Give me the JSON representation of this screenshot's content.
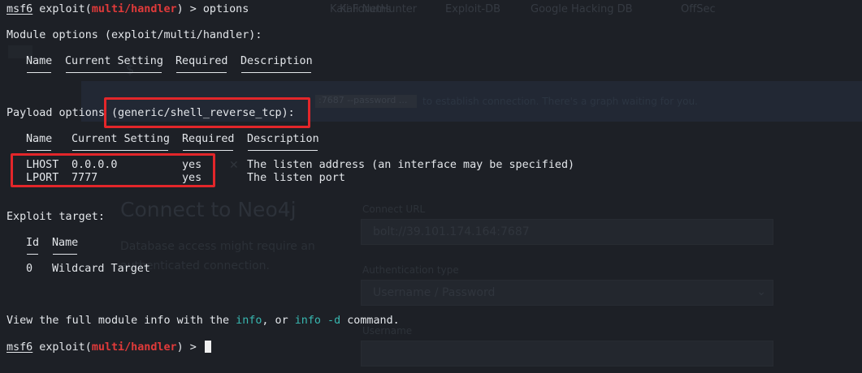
{
  "background": {
    "bookmarks": [
      "Kali Forums",
      "Kali NetHunter",
      "Exploit-DB",
      "Google Hacking DB",
      "OffSec"
    ],
    "banner_code": ":7687 --password ...",
    "banner_text": "to establish connection. There's a graph waiting for you.",
    "heading": "Connect to Neo4j",
    "subtext_line1": "Database access might require an",
    "subtext_line2": "authenticated connection.",
    "connect_url_label": "Connect URL",
    "connect_url_value": "bolt://39.101.174.164:7687",
    "auth_type_label": "Authentication type",
    "auth_type_value": "Username / Password",
    "username_label": "Username"
  },
  "prompt": {
    "msf": "msf6",
    "exploit_open": " exploit(",
    "module": "multi/handler",
    "exploit_close": ") > ",
    "command": "options"
  },
  "module_options": {
    "title": "Module options (exploit/multi/handler):",
    "headers": [
      "Name",
      "Current Setting",
      "Required",
      "Description"
    ]
  },
  "payload_options": {
    "title_prefix": "Payload options ",
    "title_payload": "(generic/shell_reverse_tcp):",
    "headers": [
      "Name",
      "Current Setting",
      "Required",
      "Description"
    ],
    "rows": [
      {
        "name": "LHOST",
        "setting": "0.0.0.0",
        "required": "yes",
        "description": "The listen address (an interface may be specified)"
      },
      {
        "name": "LPORT",
        "setting": "7777",
        "required": "yes",
        "description": "The listen port"
      }
    ]
  },
  "exploit_target": {
    "title": "Exploit target:",
    "headers": [
      "Id",
      "Name"
    ],
    "rows": [
      {
        "id": "0",
        "name": "Wildcard Target"
      }
    ]
  },
  "info_line": {
    "prefix": "View the full module info with the ",
    "cmd1": "info",
    "middle": ", or ",
    "cmd2": "info -d",
    "suffix": " command."
  },
  "colors": {
    "accent_red": "#e03a3a",
    "highlight_box": "#e3262a",
    "command_teal": "#38b7b0"
  }
}
